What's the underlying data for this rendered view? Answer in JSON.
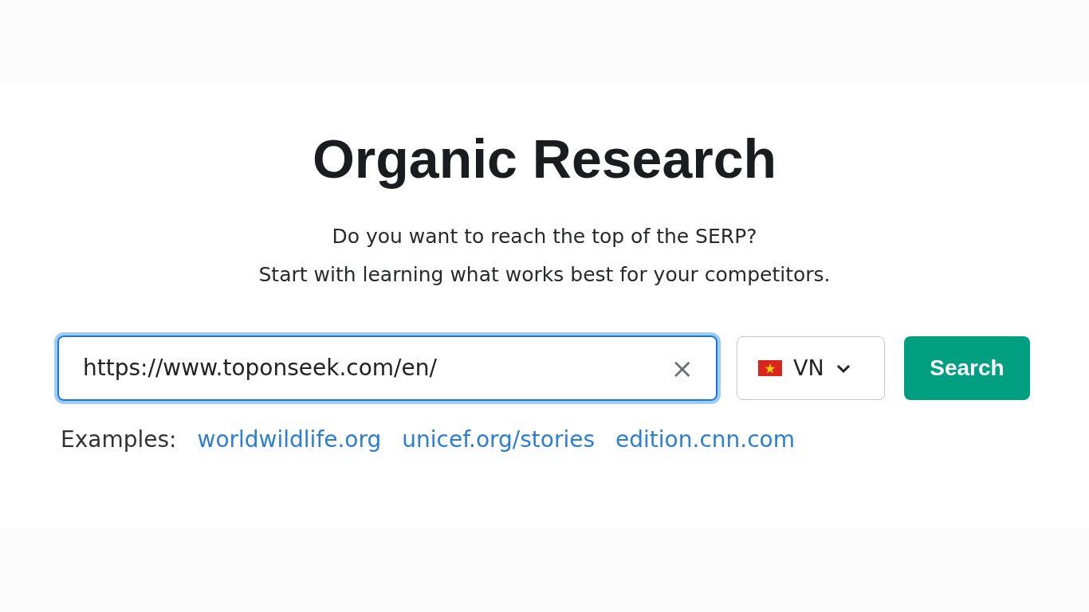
{
  "title": "Organic Research",
  "subtitle": [
    "Do you want to reach the top of the SERP?",
    "Start with learning what works best for your competitors."
  ],
  "search": {
    "value": "https://www.toponseek.com/en/",
    "focused": true,
    "clear": "×"
  },
  "country": {
    "code": "VN"
  },
  "button": "Search",
  "examples": {
    "label": "Examples:",
    "links": [
      "worldwildlife.org",
      "unicef.org/stories",
      "edition.cnn.com"
    ]
  }
}
